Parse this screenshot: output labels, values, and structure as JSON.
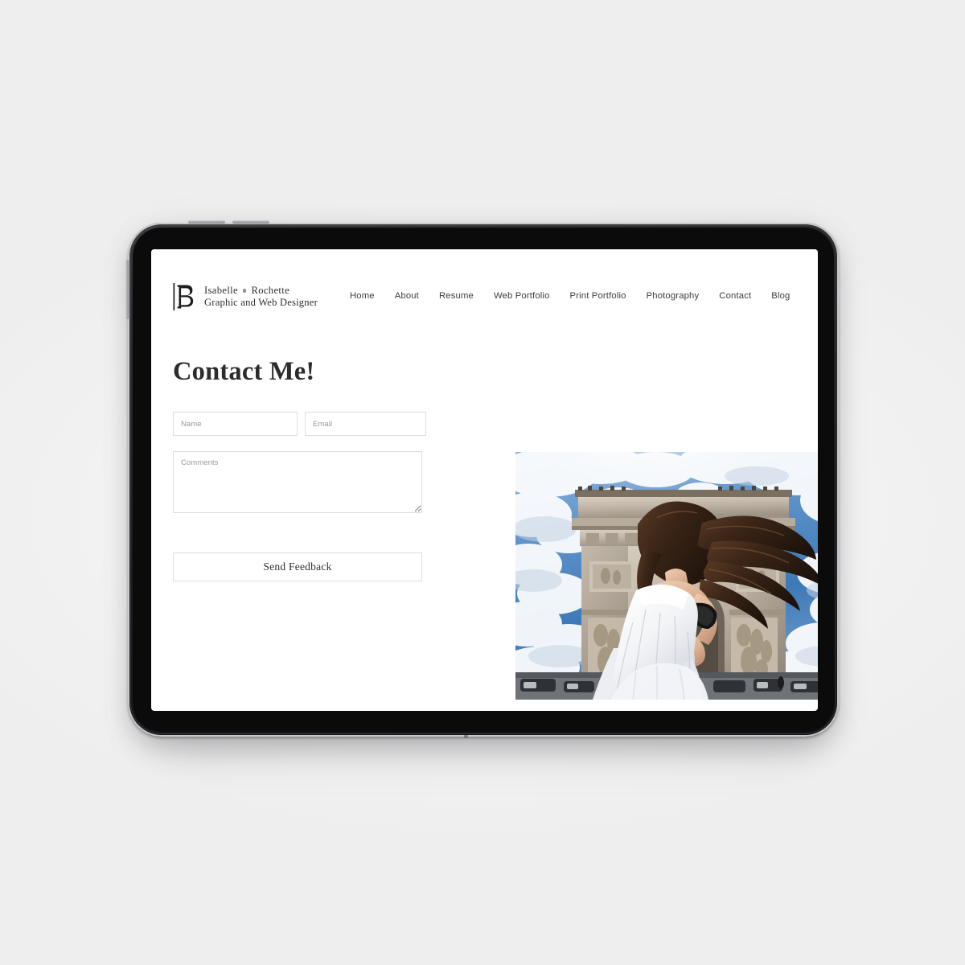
{
  "site": {
    "brand": {
      "logo_icon": "monogram-ir-logo",
      "name_first": "Isabelle",
      "separator_icon": "bullet-dot",
      "name_last": "Rochette",
      "tagline": "Graphic and Web Designer"
    },
    "nav": {
      "items": [
        {
          "label": "Home"
        },
        {
          "label": "About"
        },
        {
          "label": "Resume"
        },
        {
          "label": "Web Portfolio"
        },
        {
          "label": "Print Portfolio"
        },
        {
          "label": "Photography"
        },
        {
          "label": "Contact"
        },
        {
          "label": "Blog"
        }
      ]
    },
    "page": {
      "title": "Contact Me!"
    },
    "form": {
      "name_value": "",
      "name_placeholder": "Name",
      "email_value": "",
      "email_placeholder": "Email",
      "comments_value": "",
      "comments_placeholder": "Comments",
      "submit_label": "Send Feedback"
    },
    "hero": {
      "photo_alt": "Woman in a white dress with flowing hair in front of the Arc de Triomphe, Paris",
      "photo_icon": "hero-photograph"
    }
  },
  "device": {
    "type": "tablet",
    "buttons": {
      "volume_up": "volume-up-button",
      "volume_down": "volume-down-button",
      "power": "power-button"
    }
  },
  "colors": {
    "background": "#f4f4f4",
    "screen": "#ffffff",
    "bezel": "#0b0b0c",
    "rim": "#d7d8db",
    "text_dark": "#2c2c2e",
    "text_nav": "#3c3c3e",
    "placeholder": "#9b9b9b",
    "border": "#dcdcdc",
    "brand_dot": "#8d9196"
  }
}
